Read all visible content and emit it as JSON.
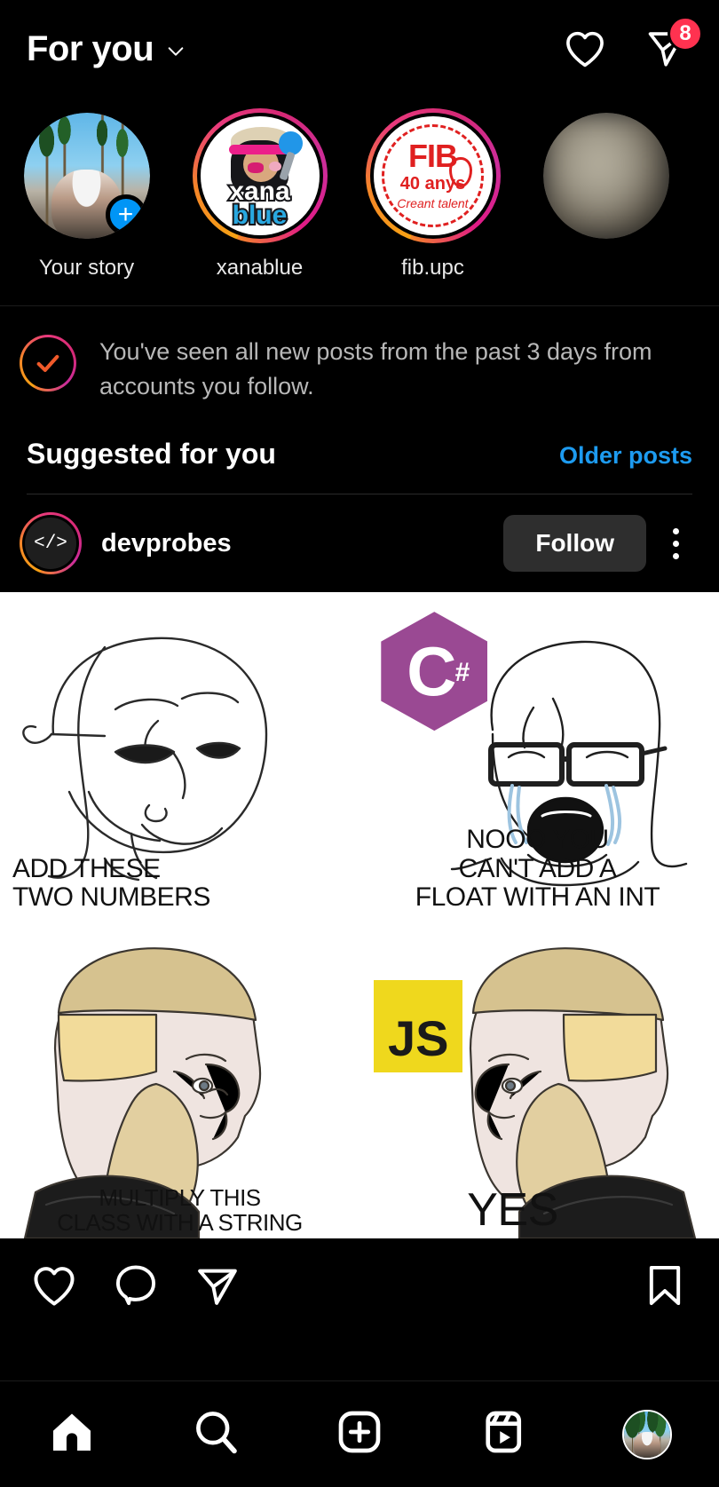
{
  "header": {
    "title": "For you",
    "chevron_icon": "chevron-down-icon",
    "heart_icon": "heart-icon",
    "messages_icon": "direct-message-icon",
    "messages_badge": "8"
  },
  "stories": [
    {
      "label": "Your story",
      "has_ring": false,
      "has_plus": true,
      "avatar_kind": "selfie"
    },
    {
      "label": "xanablue",
      "has_ring": true,
      "has_plus": false,
      "avatar_kind": "xanablue"
    },
    {
      "label": "fib.upc",
      "has_ring": true,
      "has_plus": false,
      "avatar_kind": "fib"
    },
    {
      "label": "",
      "has_ring": false,
      "has_plus": false,
      "avatar_kind": "blurred"
    }
  ],
  "seen_banner": {
    "icon": "check-circle-icon",
    "text": "You've seen all new posts from the past 3 days from accounts you follow."
  },
  "suggested": {
    "title": "Suggested for you",
    "older_posts_link": "Older posts"
  },
  "post": {
    "username": "devprobes",
    "avatar_glyph": "</>",
    "follow_label": "Follow",
    "more_icon": "more-options-icon",
    "media": {
      "panels": [
        {
          "caption": "ADD THESE\nTWO NUMBERS",
          "logo": ""
        },
        {
          "caption": "NOOO YOU\nCAN'T ADD A\nFLOAT WITH AN INT",
          "logo": "csharp"
        },
        {
          "caption": "MULTIPLY THIS\nCLASS WITH A STRING",
          "logo": ""
        },
        {
          "caption": "YES",
          "logo": "js"
        }
      ],
      "csharp_logo": {
        "letter": "C",
        "sharp": "#",
        "color": "#9a4993"
      },
      "js_logo": {
        "text": "JS",
        "color": "#efd81d"
      }
    },
    "actions": {
      "like_icon": "heart-icon",
      "comment_icon": "comment-icon",
      "share_icon": "share-icon",
      "save_icon": "bookmark-icon"
    }
  },
  "bottom_nav": [
    {
      "icon": "home-icon",
      "name": "home"
    },
    {
      "icon": "search-icon",
      "name": "search"
    },
    {
      "icon": "create-icon",
      "name": "create"
    },
    {
      "icon": "reels-icon",
      "name": "reels"
    },
    {
      "icon": "profile-avatar",
      "name": "profile"
    }
  ],
  "colors": {
    "background": "#000000",
    "accent_blue": "#1d9bf0",
    "badge_red": "#ff3250",
    "plus_blue": "#0095f6",
    "follow_bg": "#2e2e2e"
  }
}
